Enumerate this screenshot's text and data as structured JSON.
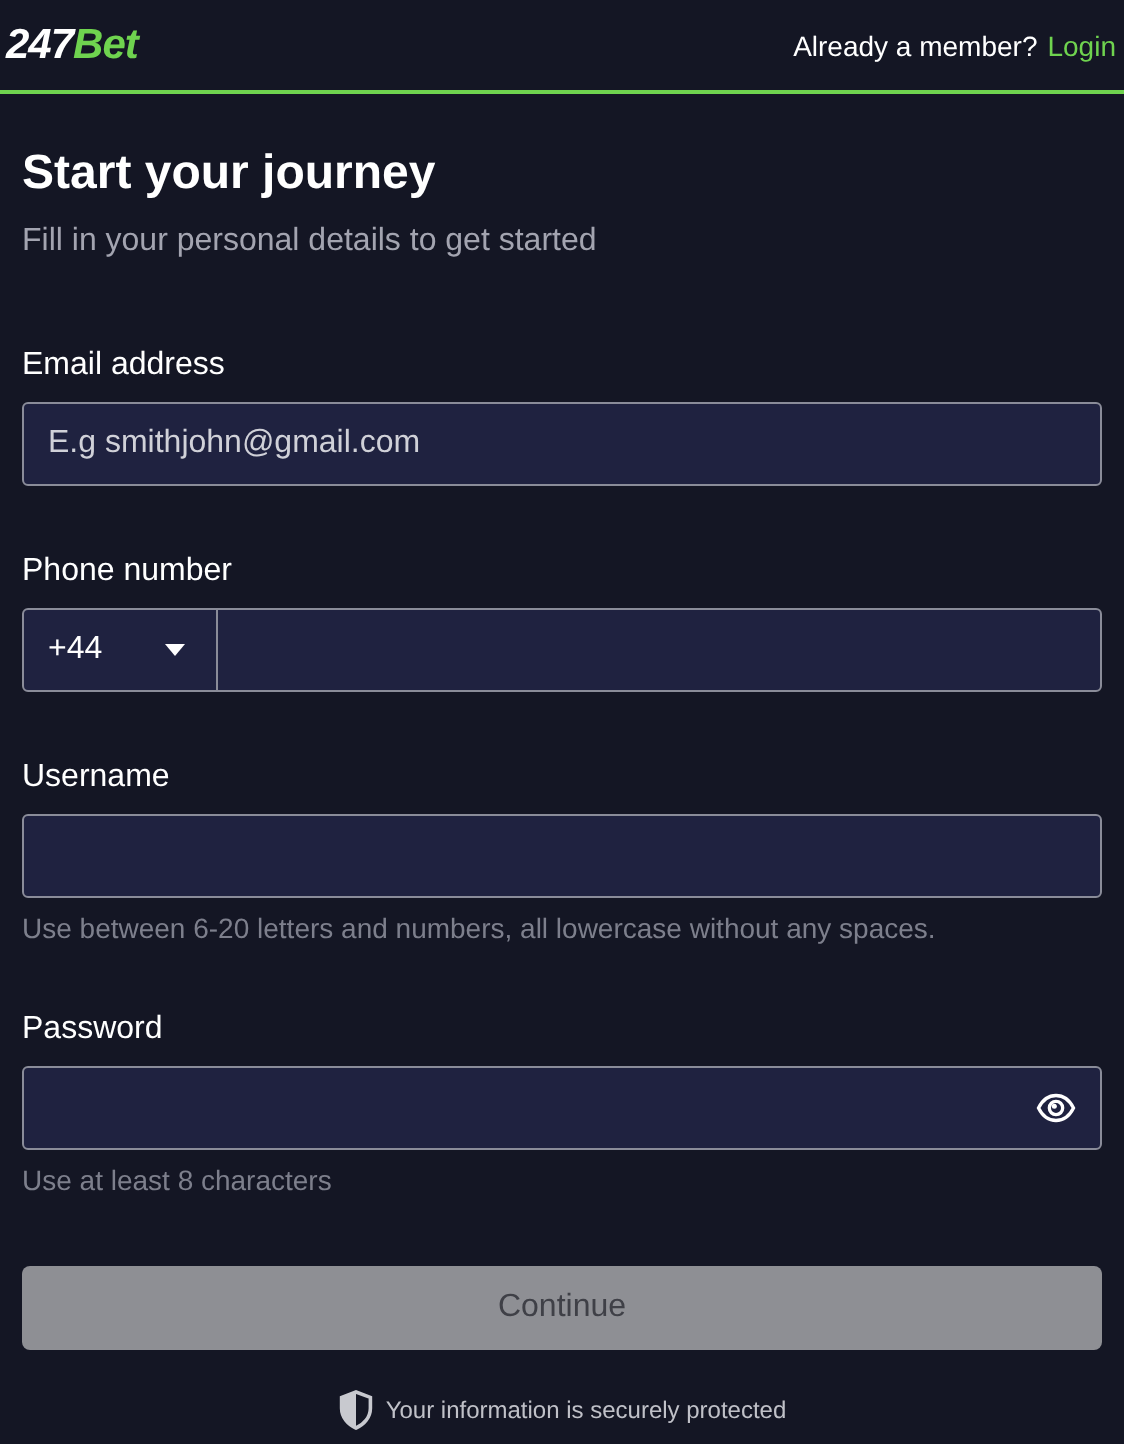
{
  "header": {
    "logo": {
      "part_1": "247",
      "part_2": "Bet"
    },
    "prompt": "Already a member?",
    "login_link": "Login"
  },
  "title": "Start your journey",
  "subtitle": "Fill in your personal details to get started",
  "fields": [
    {
      "kind": "text",
      "label": "Email address",
      "placeholder": "E.g smithjohn@gmail.com"
    },
    {
      "kind": "phone",
      "label": "Phone number",
      "country_code": "+44"
    },
    {
      "kind": "text",
      "label": "Username",
      "hint": "Use between 6-20 letters and numbers, all lowercase without any spaces."
    },
    {
      "kind": "password",
      "label": "Password",
      "hint": "Use at least 8 characters"
    }
  ],
  "continue_button": {
    "label": "Continue",
    "disabled": true
  },
  "security_note": "Your information is securely protected"
}
